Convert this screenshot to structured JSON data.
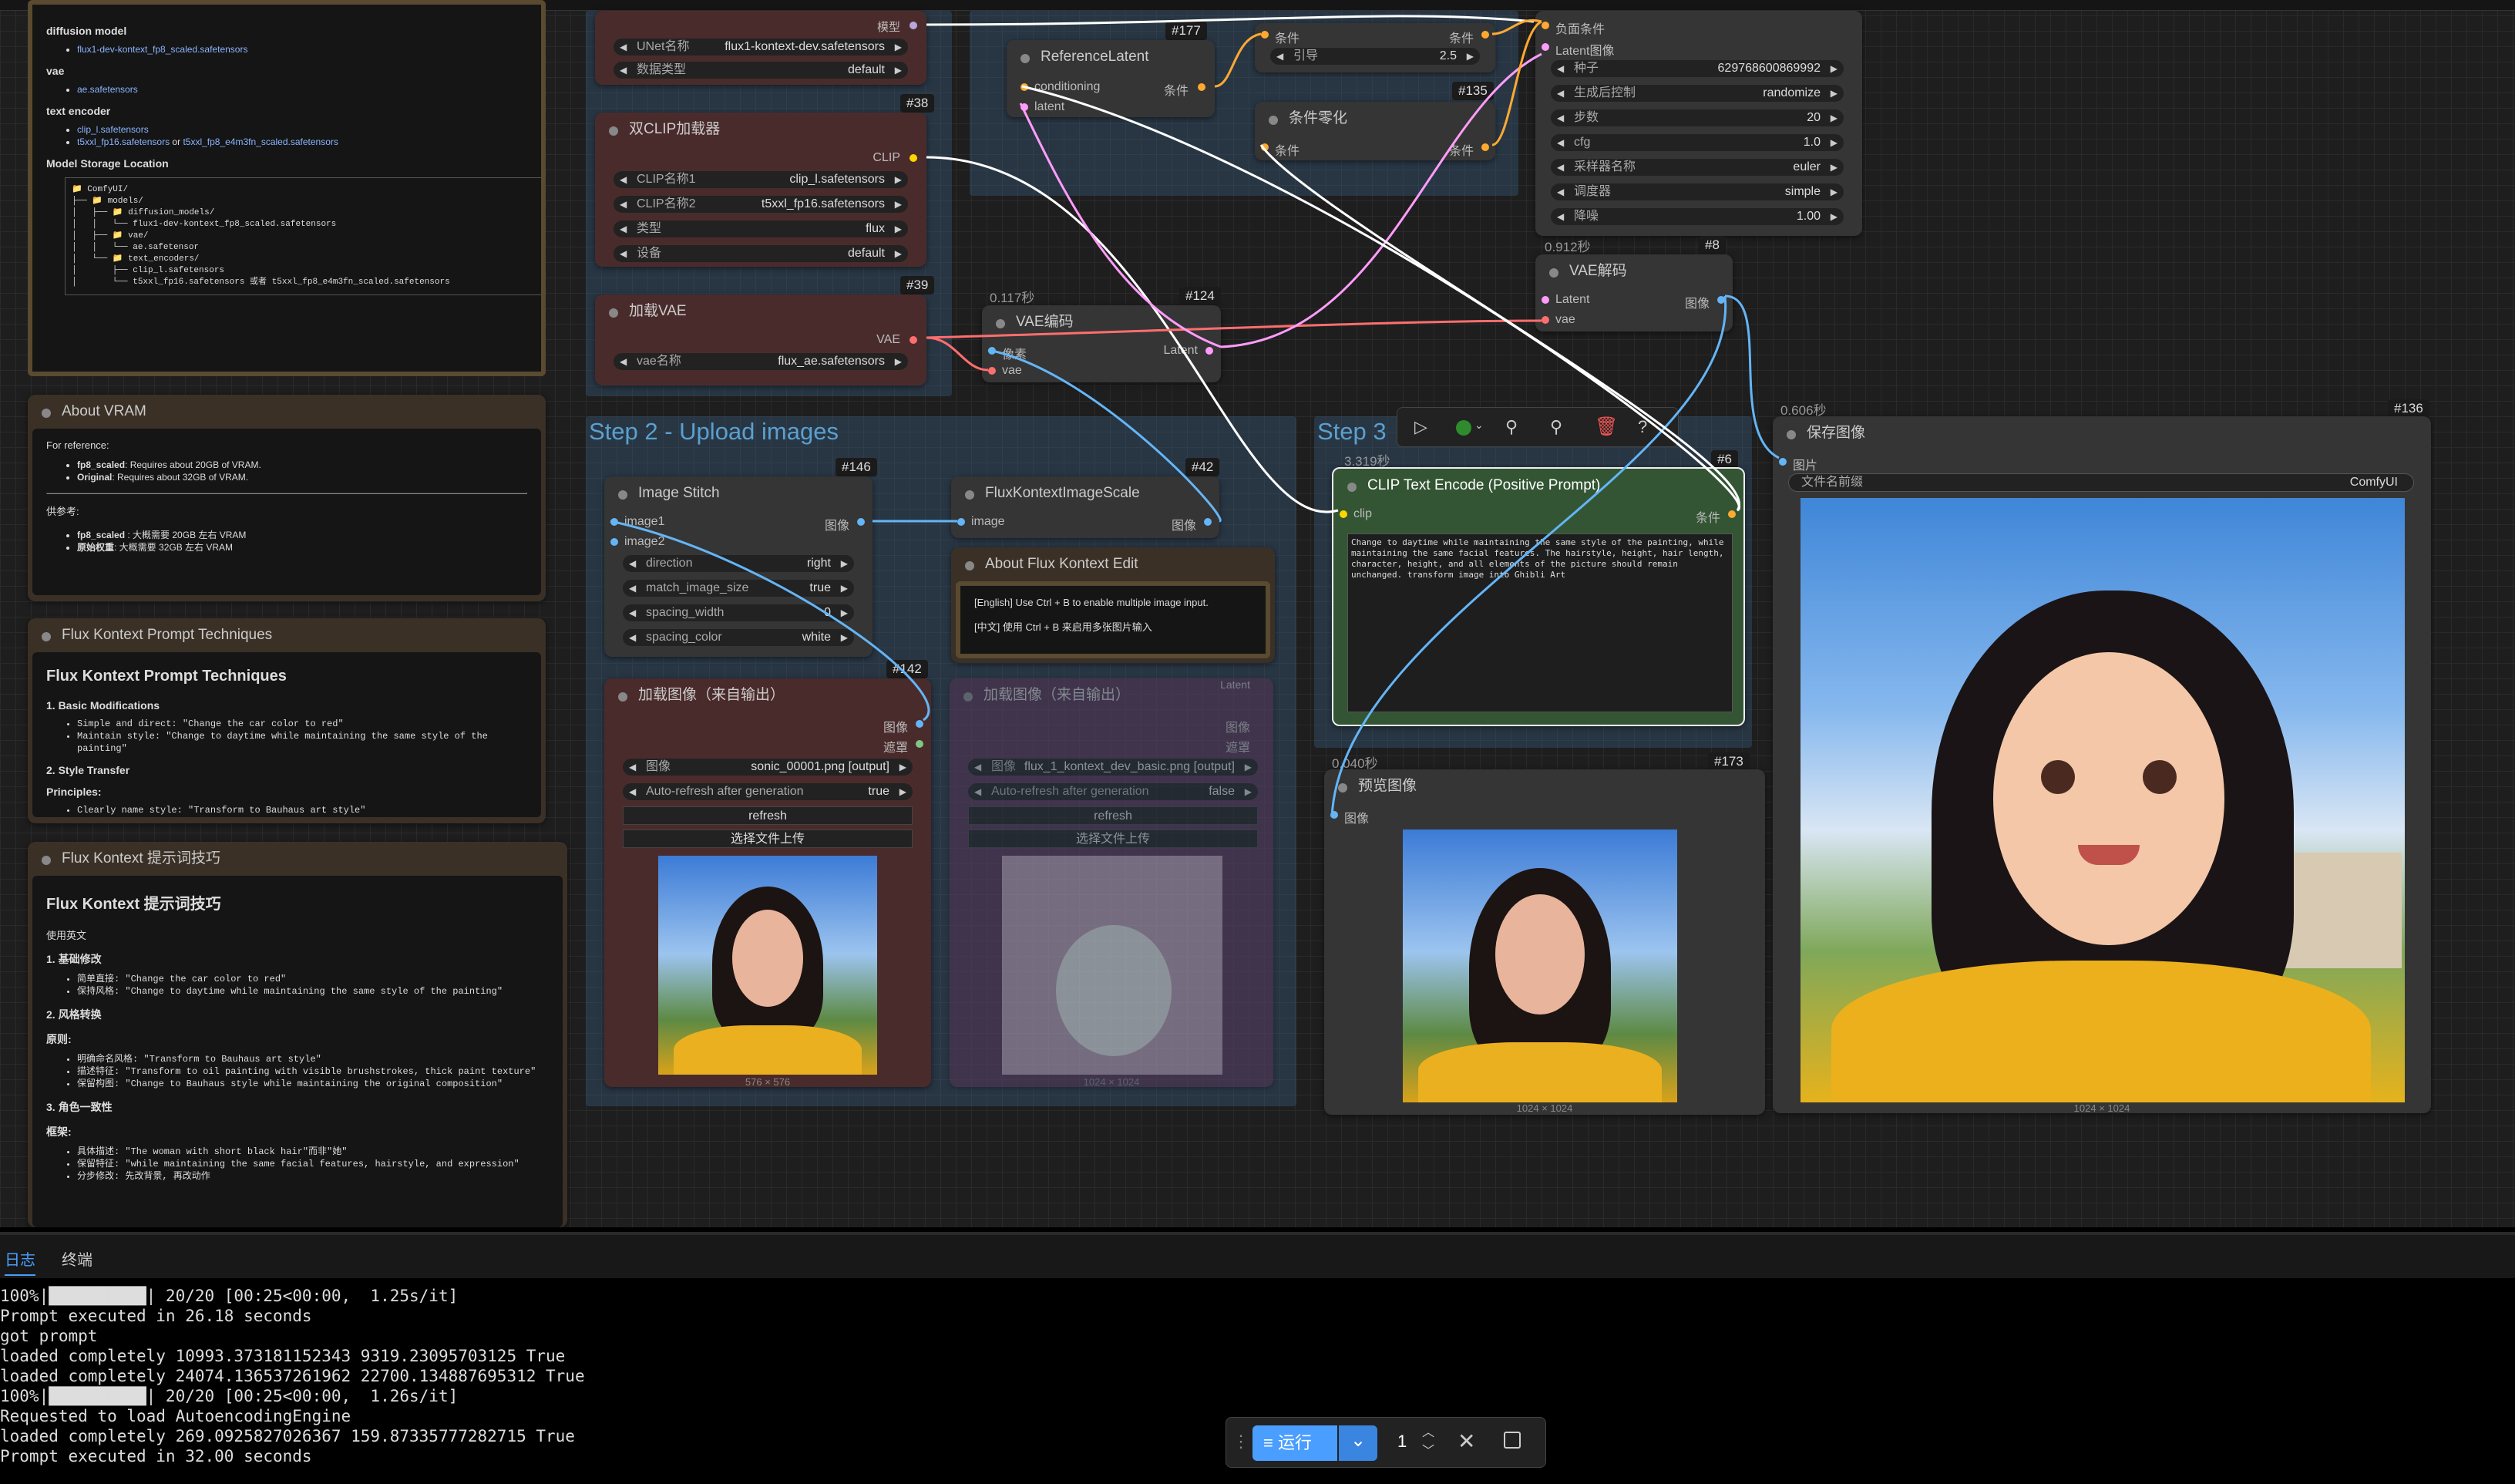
{
  "nodes": {
    "unet": {
      "label_model": "模型",
      "unet_name_label": "UNet名称",
      "unet_name": "flux1-kontext-dev.safetensors",
      "dtype_label": "数据类型",
      "dtype": "default",
      "id": "#38"
    },
    "dualclip": {
      "title": "双CLIP加载器",
      "out": "CLIP",
      "clip1_label": "CLIP名称1",
      "clip1": "clip_l.safetensors",
      "clip2_label": "CLIP名称2",
      "clip2": "t5xxl_fp16.safetensors",
      "type_label": "类型",
      "type": "flux",
      "device_label": "设备",
      "device": "default",
      "id": "#39"
    },
    "vae_loader": {
      "title": "加载VAE",
      "out": "VAE",
      "name_label": "vae名称",
      "name": "flux_ae.safetensors"
    },
    "ref_latent": {
      "title": "ReferenceLatent",
      "in1": "conditioning",
      "in2": "latent",
      "out": "条件",
      "id": "#177"
    },
    "flux_guidance": {
      "in": "条件",
      "out": "条件",
      "label": "引导",
      "value": "2.5",
      "id": "#135"
    },
    "cond_zero": {
      "title": "条件零化",
      "in": "条件",
      "out": "条件"
    },
    "ksampler": {
      "neg": "负面条件",
      "latent": "Latent图像",
      "seed_label": "种子",
      "seed": "629768600869992",
      "after_label": "生成后控制",
      "after": "randomize",
      "steps_label": "步数",
      "steps": "20",
      "cfg_label": "cfg",
      "cfg": "1.0",
      "sampler_label": "采样器名称",
      "sampler": "euler",
      "scheduler_label": "调度器",
      "scheduler": "simple",
      "denoise_label": "降噪",
      "denoise": "1.00"
    },
    "vae_decode": {
      "time": "0.912秒",
      "id": "#8",
      "title": "VAE解码",
      "in1": "Latent",
      "in2": "vae",
      "out": "图像"
    },
    "vae_encode": {
      "time": "0.117秒",
      "id": "#124",
      "title": "VAE编码",
      "in1": "像素",
      "in2": "vae",
      "out": "Latent"
    },
    "image_stitch": {
      "title": "Image Stitch",
      "id": "#146",
      "in1": "image1",
      "in2": "image2",
      "out": "图像",
      "direction_label": "direction",
      "direction": "right",
      "match_label": "match_image_size",
      "match": "true",
      "spacing_label": "spacing_width",
      "spacing": "0",
      "color_label": "spacing_color",
      "color": "white"
    },
    "scale": {
      "title": "FluxKontextImageScale",
      "id": "#42",
      "in": "image",
      "out": "图像"
    },
    "load_img1": {
      "title": "加载图像（来自输出）",
      "id": "#142",
      "out1": "图像",
      "out2": "遮罩",
      "image_label": "图像",
      "image": "sonic_00001.png [output]",
      "auto_label": "Auto-refresh after generation",
      "auto": "true",
      "refresh": "refresh",
      "upload": "选择文件上传",
      "size": "576 × 576"
    },
    "load_img2": {
      "title": "加载图像（来自输出）",
      "out1": "图像",
      "out2": "遮罩",
      "image_label": "图像",
      "image": "flux_1_kontext_dev_basic.png [output]",
      "auto_label": "Auto-refresh after generation",
      "auto": "false",
      "refresh": "refresh",
      "upload": "选择文件上传",
      "size": "1024 × 1024",
      "hidden_out": "Latent"
    },
    "about_kontext": {
      "title": "About Flux Kontext Edit",
      "line1": "[English] Use Ctrl + B to enable multiple image input.",
      "line2": "[中文] 使用 Ctrl + B 来启用多张图片输入"
    },
    "clip_encode": {
      "time": "3.319秒",
      "id": "#6",
      "title": "CLIP Text Encode (Positive Prompt)",
      "in": "clip",
      "out": "条件",
      "prompt": "Change to daytime while maintaining the same style of the painting, while maintaining the same facial features. The hairstyle, height, hair length, character, height, and all elements of the picture should remain unchanged. transform image into Ghibli Art"
    },
    "preview": {
      "time": "0.040秒",
      "id": "#173",
      "title": "预览图像",
      "in": "图像",
      "size": "1024 × 1024"
    },
    "save": {
      "time": "0.606秒",
      "id": "#136",
      "title": "保存图像",
      "in": "图片",
      "prefix_label": "文件名前缀",
      "prefix": "ComfyUI",
      "size": "1024 × 1024"
    }
  },
  "groups": {
    "step2": "Step 2 - Upload images",
    "step3": "Step 3"
  },
  "notes": {
    "models": {
      "diffusion": "diffusion model",
      "diffusion_file": "flux1-dev-kontext_fp8_scaled.safetensors",
      "vae": "vae",
      "vae_file": "ae.safetensors",
      "te": "text encoder",
      "te_file1": "clip_l.safetensors",
      "te_file2": "t5xxl_fp16.safetensors",
      "te_or": "or",
      "te_file3": "t5xxl_fp8_e4m3fn_scaled.safetensors",
      "storage": "Model Storage Location",
      "tree": [
        "📁 ComfyUI/",
        "├── 📁 models/",
        "│   ├── 📁 diffusion_models/",
        "│   │   └── flux1-dev-kontext_fp8_scaled.safetensors",
        "│   ├── 📁 vae/",
        "│   │   └── ae.safetensor",
        "│   └── 📁 text_encoders/",
        "│       ├── clip_l.safetensors",
        "│       └── t5xxl_fp16.safetensors 或者 t5xxl_fp8_e4m3fn_scaled.safetensors"
      ]
    },
    "vram": {
      "title": "About VRAM",
      "ref": "For reference:",
      "l1b": "fp8_scaled",
      "l1": ": Requires about 20GB of VRAM.",
      "l2b": "Original",
      "l2": ": Requires about 32GB of VRAM.",
      "cn": "供参考:",
      "c1b": "fp8_scaled",
      "c1": " : 大概需要 20GB 左右 VRAM",
      "c2b": "原始权重",
      "c2": ": 大概需要 32GB 左右 VRAM"
    },
    "tech_en": {
      "title": "Flux Kontext Prompt Techniques",
      "h": "Flux Kontext Prompt Techniques",
      "s1": "1. Basic Modifications",
      "b1": "Simple and direct: \"Change the car color to red\"",
      "b2": "Maintain style: \"Change to daytime while maintaining the same style of the painting\"",
      "s2": "2. Style Transfer",
      "s3": "Principles:",
      "b3": "Clearly name style: \"Transform to Bauhaus art style\""
    },
    "tech_cn": {
      "title": "Flux Kontext 提示词技巧",
      "h": "Flux Kontext 提示词技巧",
      "intro": "使用英文",
      "s1": "1. 基础修改",
      "b1": "简单直接: \"Change the car color to red\"",
      "b2": "保持风格: \"Change to daytime while maintaining the same style of the painting\"",
      "s2": "2. 风格转换",
      "p": "原则:",
      "b3": "明确命名风格: \"Transform to Bauhaus art style\"",
      "b4": "描述特征: \"Transform to oil painting with visible brushstrokes, thick paint texture\"",
      "b5": "保留构图: \"Change to Bauhaus style while maintaining the original composition\"",
      "s3": "3. 角色一致性",
      "f": "框架:",
      "b6": "具体描述: \"The woman with short black hair\"而非\"她\"",
      "b7": "保留特征: \"while maintaining the same facial features, hairstyle, and expression\"",
      "b8": "分步修改: 先改背景, 再改动作"
    }
  },
  "bottom": {
    "tab1": "日志",
    "tab2": "终端",
    "log": [
      "100%|██████████| 20/20 [00:25<00:00,  1.25s/it]",
      "Prompt executed in 26.18 seconds",
      "got prompt",
      "loaded completely 10993.373181152343 9319.23095703125 True",
      "loaded completely 24074.136537261962 22700.134887695312 True",
      "100%|██████████| 20/20 [00:25<00:00,  1.26s/it]",
      "Requested to load AutoencodingEngine",
      "loaded completely 269.0925827026367 159.87335777282715 True",
      "Prompt executed in 32.00 seconds"
    ],
    "run_label": "运行",
    "batch": "1"
  },
  "colors": {
    "accent": "#4a9eff",
    "wire_white": "#ffffff",
    "wire_pink": "#ee88dd",
    "wire_red": "#ee5566",
    "wire_yellow": "#ffcc33",
    "wire_blue": "#5599dd"
  }
}
